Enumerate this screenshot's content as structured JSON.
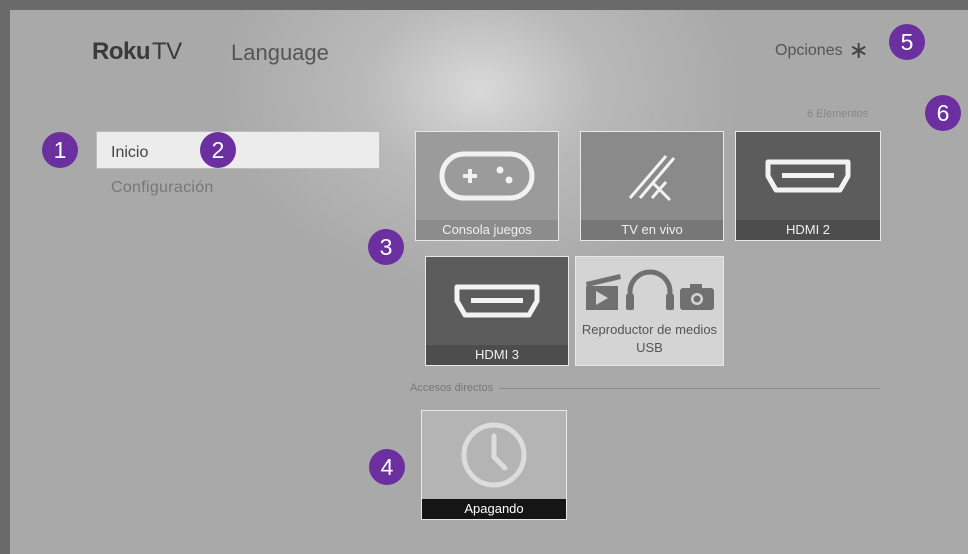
{
  "header": {
    "brand_bold": "Roku",
    "brand_light": "TV",
    "title": "Language",
    "options_label": "Opciones",
    "options_icon": "asterisk-icon"
  },
  "grid": {
    "count_label": "6 Elementos",
    "tiles": [
      {
        "label": "Consola juegos",
        "icon": "gamepad-icon"
      },
      {
        "label": "TV en vivo",
        "icon": "antenna-icon"
      },
      {
        "label": "HDMI 2",
        "icon": "hdmi-icon"
      },
      {
        "label": "HDMI 3",
        "icon": "hdmi-icon"
      },
      {
        "label": "Reproductor de medios USB",
        "icon": "media-icons"
      }
    ]
  },
  "menu": {
    "items": [
      {
        "label": "Inicio",
        "selected": true
      },
      {
        "label": "Configuración",
        "selected": false
      }
    ]
  },
  "shortcuts": {
    "section_label": "Accesos directos",
    "tiles": [
      {
        "label": "Apagando",
        "icon": "clock-icon"
      }
    ]
  },
  "badges": [
    "1",
    "2",
    "3",
    "4",
    "5",
    "6"
  ],
  "colors": {
    "badge": "#6b2fa0",
    "background": "#a9a9a9"
  }
}
